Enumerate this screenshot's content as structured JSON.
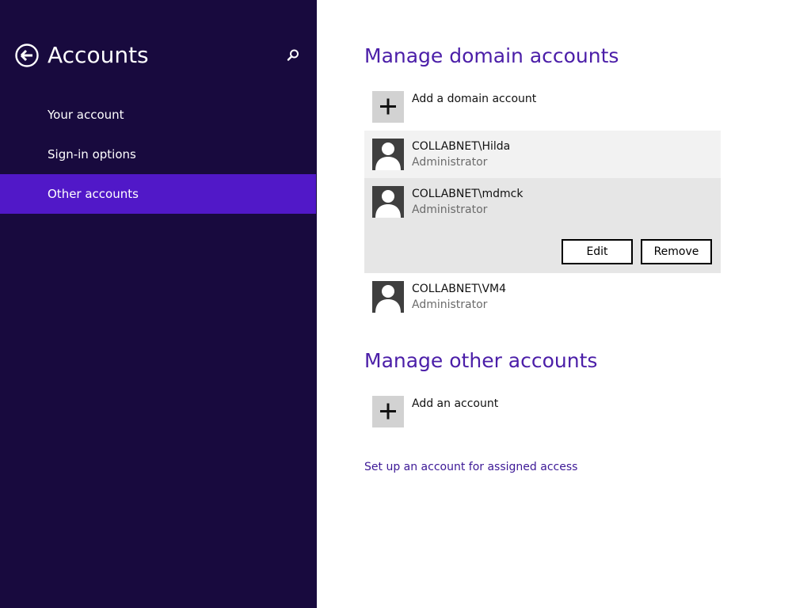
{
  "sidebar": {
    "title": "Accounts",
    "back_icon": "back-arrow-icon",
    "search_icon": "search-icon",
    "items": [
      {
        "label": "Your account"
      },
      {
        "label": "Sign-in options"
      },
      {
        "label": "Other accounts",
        "selected": true
      }
    ],
    "colors": {
      "background": "#180a3e",
      "selected": "#5118c8"
    }
  },
  "main": {
    "domain_section": {
      "title": "Manage domain accounts",
      "add_label": "Add a domain account",
      "add_icon": "plus-icon",
      "accounts": [
        {
          "name": "COLLABNET\\Hilda",
          "role": "Administrator"
        },
        {
          "name": "COLLABNET\\mdmck",
          "role": "Administrator",
          "expanded": true
        },
        {
          "name": "COLLABNET\\VM4",
          "role": "Administrator"
        }
      ],
      "edit_label": "Edit",
      "remove_label": "Remove"
    },
    "other_section": {
      "title": "Manage other accounts",
      "add_label": "Add an account",
      "add_icon": "plus-icon"
    },
    "assigned_access_link": "Set up an account for assigned access",
    "colors": {
      "heading": "#4b1ea8",
      "link": "#3c1896"
    }
  }
}
